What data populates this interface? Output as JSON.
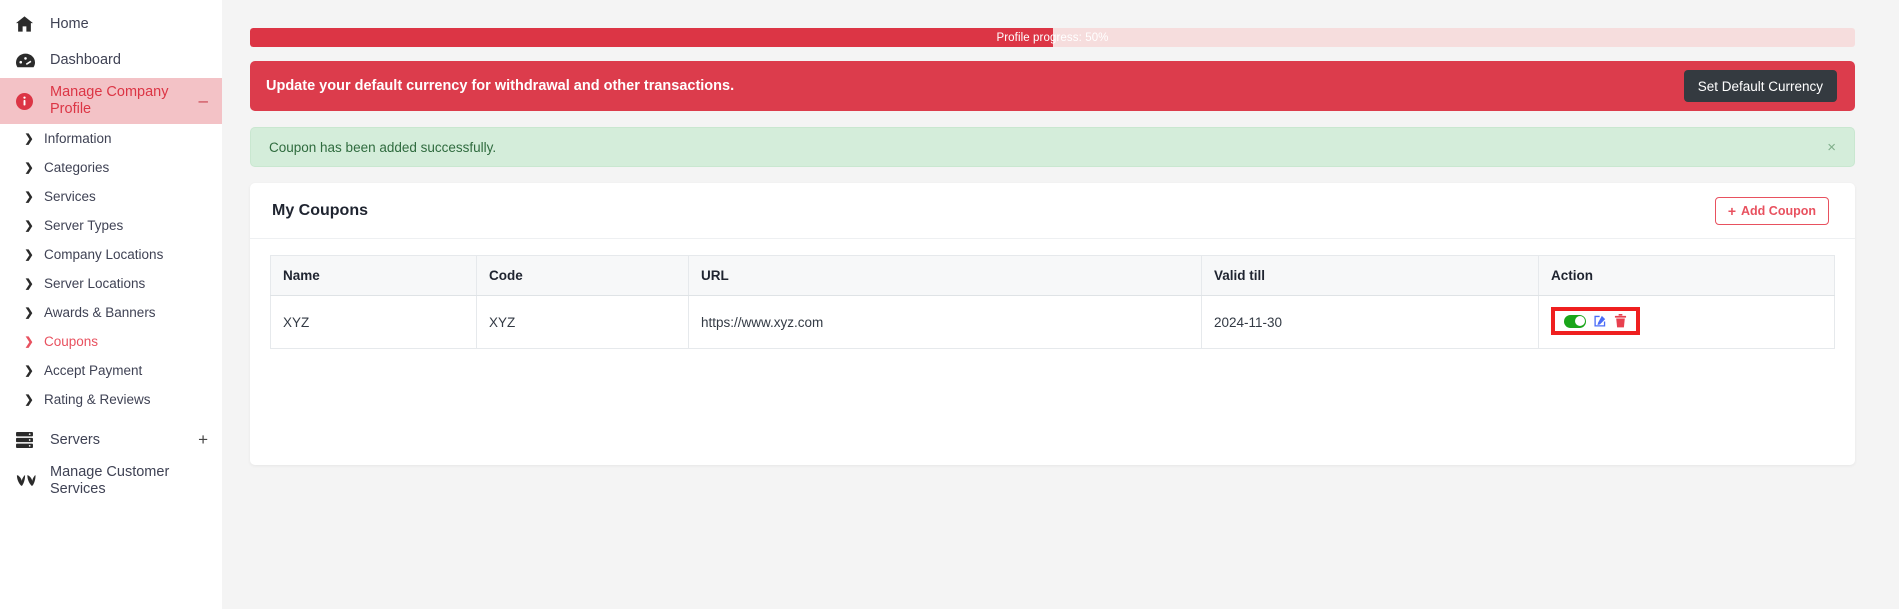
{
  "sidebar": {
    "top_items": [
      {
        "label": "Home",
        "icon": "home-icon"
      },
      {
        "label": "Dashboard",
        "icon": "dashboard-icon"
      }
    ],
    "active_item": {
      "label": "Manage Company Profile",
      "icon": "info-circle-icon",
      "suffix": "–"
    },
    "sub_items": [
      {
        "label": "Information"
      },
      {
        "label": "Categories"
      },
      {
        "label": "Services"
      },
      {
        "label": "Server Types"
      },
      {
        "label": "Company Locations"
      },
      {
        "label": "Server Locations"
      },
      {
        "label": "Awards & Banners"
      },
      {
        "label": "Coupons"
      },
      {
        "label": "Accept Payment"
      },
      {
        "label": "Rating & Reviews"
      }
    ],
    "selected_sub_index": 7,
    "bottom_items": [
      {
        "label": "Servers",
        "icon": "server-icon",
        "suffix": "+"
      },
      {
        "label": "Manage Customer Services",
        "icon": "hands-icon",
        "suffix": ""
      }
    ],
    "active_bg": "#f3c2c6",
    "accent": "#dc3545"
  },
  "progress": {
    "label": "Profile progress: 50%",
    "percent": 50,
    "fill_color": "#dc3545",
    "track_color": "#f6dddd"
  },
  "currency_alert": {
    "message": "Update your default currency for withdrawal and other transactions.",
    "button_label": "Set Default Currency",
    "bg_color": "#dc3c4c",
    "button_color": "#343a40"
  },
  "success_alert": {
    "message": "Coupon has been added successfully.",
    "close_label": "×",
    "bg_color": "#d4edda",
    "text_color": "#2f6b3e"
  },
  "coupons_card": {
    "title": "My Coupons",
    "add_button": {
      "label": "Add Coupon",
      "plus": "+"
    },
    "table": {
      "columns": [
        "Name",
        "Code",
        "URL",
        "Valid till",
        "Action"
      ],
      "rows": [
        {
          "name": "XYZ",
          "code": "XYZ",
          "url": "https://www.xyz.com",
          "valid_till": "2024-11-30",
          "actions": {
            "toggle_state": "on",
            "toggle_color": "#1aa51a",
            "edit_icon": "edit-pencil-square-icon",
            "edit_color": "#4a6cf7",
            "delete_icon": "trash-icon",
            "delete_color": "#e8414f",
            "highlight_color": "#ef1f1f"
          }
        }
      ]
    }
  }
}
